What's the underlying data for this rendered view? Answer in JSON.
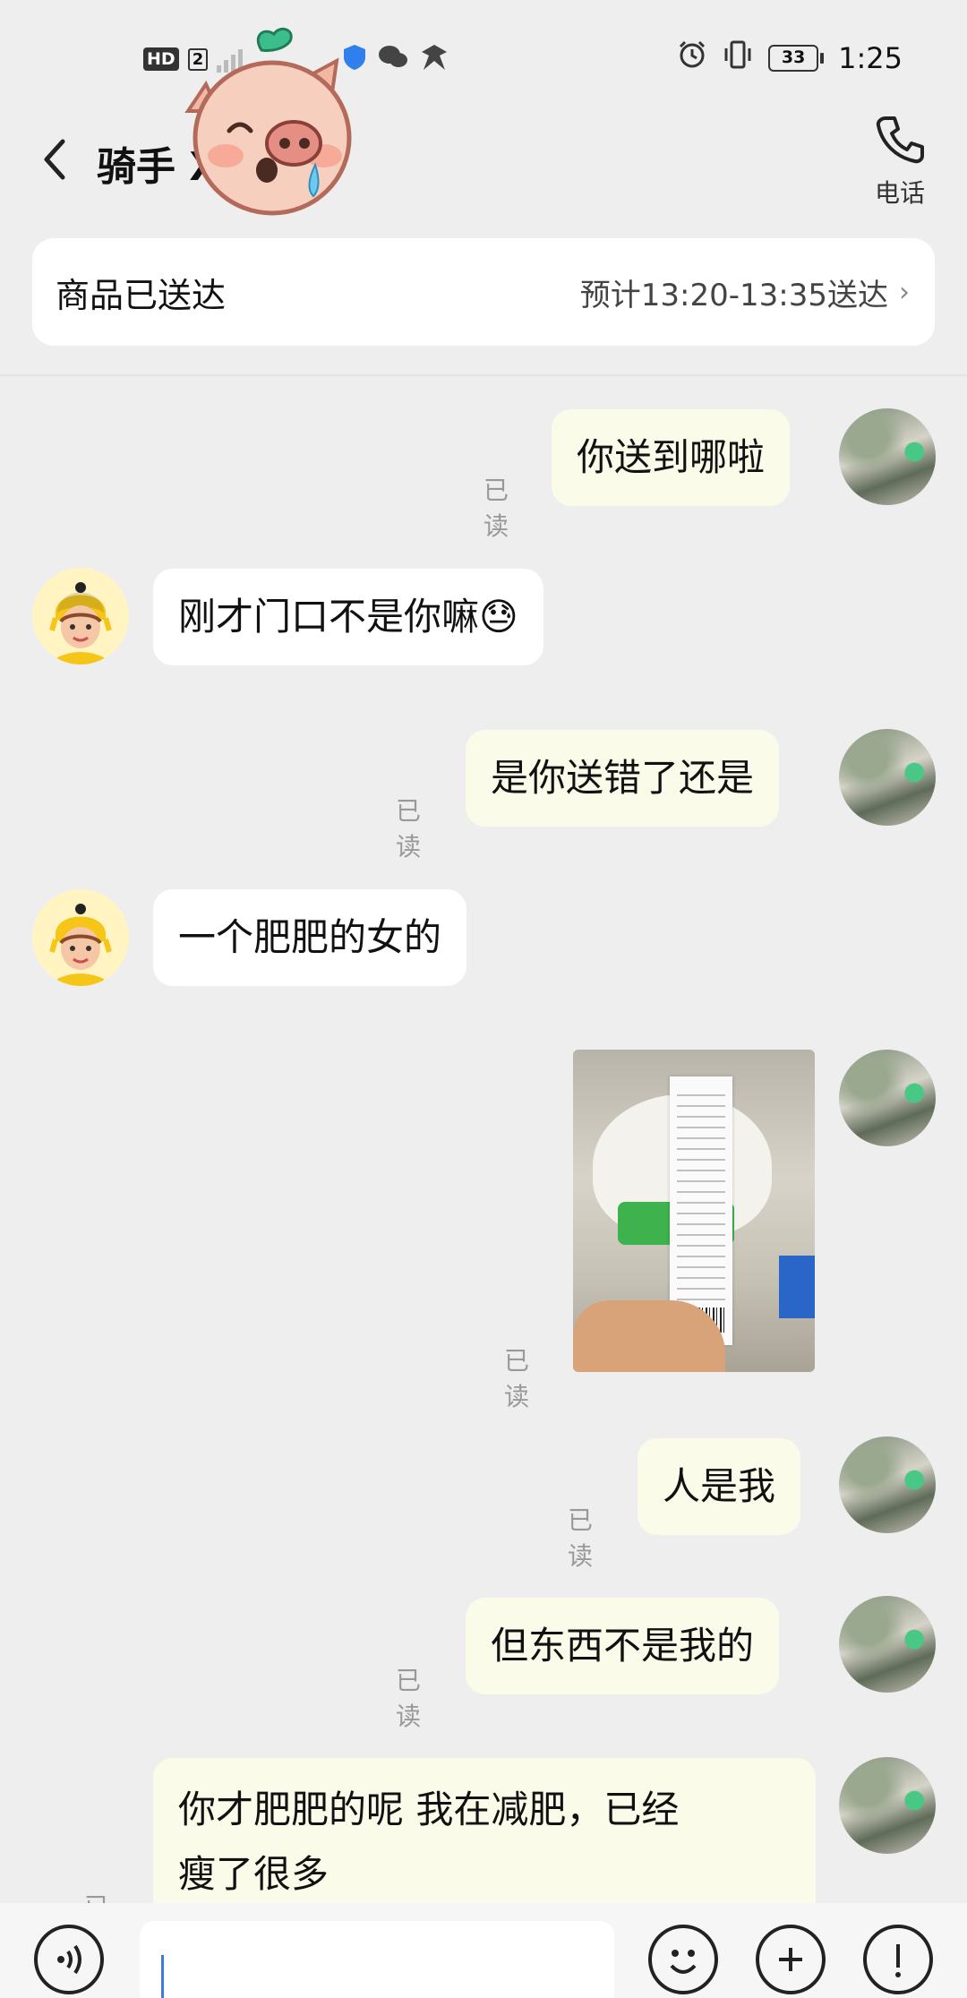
{
  "status_bar": {
    "hd": "HD",
    "sim": "2",
    "battery": "33",
    "time": "1:25"
  },
  "header": {
    "title": "骑手 X",
    "phone_label": "电话"
  },
  "order": {
    "status": "商品已送达",
    "eta": "预计13:20-13:35送达"
  },
  "read_label": "已读",
  "messages": [
    {
      "from": "me",
      "text": "你送到哪啦",
      "read": "已读"
    },
    {
      "from": "rider",
      "text": "刚才门口不是你嘛😓"
    },
    {
      "from": "me",
      "text": "是你送错了还是",
      "read": "已读"
    },
    {
      "from": "rider",
      "text": "一个肥肥的女的"
    },
    {
      "from": "me",
      "type": "image",
      "read": "已读"
    },
    {
      "from": "me",
      "text": "人是我",
      "read": "已读"
    },
    {
      "from": "me",
      "text": "但东西不是我的",
      "read": "已读"
    },
    {
      "from": "me",
      "text_line1": "你才肥肥的呢 我在减肥，已经",
      "text_line2": "瘦了很多",
      "read": "已读"
    }
  ],
  "input": {
    "placeholder": ""
  },
  "colors": {
    "background": "#eeeeee",
    "my_bubble": "#fbfbe9",
    "their_bubble": "#ffffff",
    "read_text": "#999999"
  },
  "icons": [
    "back-icon",
    "phone-icon",
    "pig-sticker",
    "voice-icon",
    "emoji-icon",
    "add-icon",
    "more-icon"
  ]
}
